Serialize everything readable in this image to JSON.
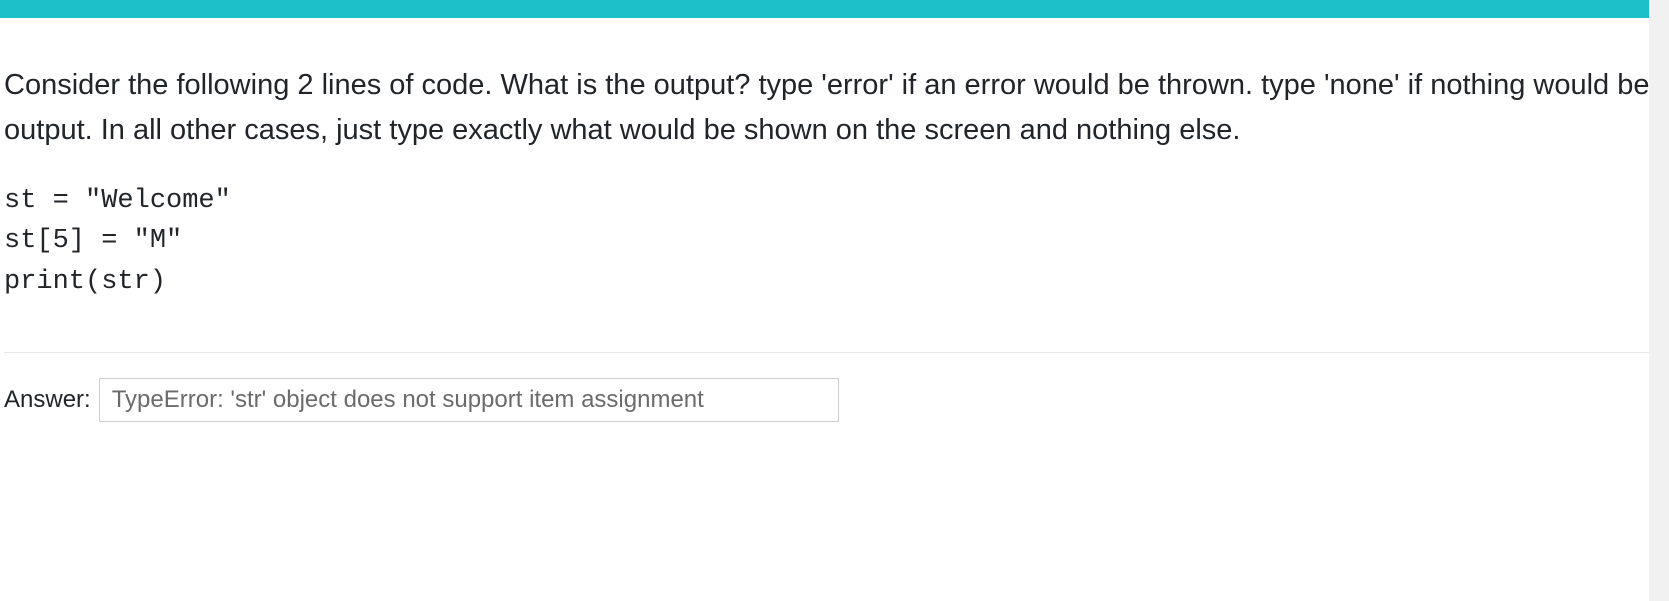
{
  "question": {
    "prompt": "Consider the following 2 lines of code. What is the output? type 'error' if an error would be thrown. type 'none' if nothing would be output. In all other cases, just type exactly what would be shown on the screen and nothing else."
  },
  "code": {
    "lines": [
      "st = \"Welcome\"",
      "st[5] = \"M\"",
      "print(str)"
    ]
  },
  "answer": {
    "label": "Answer:",
    "value": "TypeError: 'str' object does not support item assignment"
  }
}
